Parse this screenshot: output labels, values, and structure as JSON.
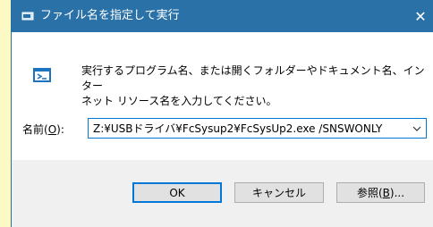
{
  "window": {
    "title": "ファイル名を指定して実行",
    "close_glyph": "✕"
  },
  "description": "実行するプログラム名、または開くフォルダーやドキュメント名、インター\nネット リソース名を入力してください。",
  "name_field": {
    "label_prefix": "名前(",
    "label_accel": "O",
    "label_suffix": "):",
    "value": "Z:¥USBドライバ¥FcSysup2¥FcSysUp2.exe  /SNSWONLY"
  },
  "buttons": {
    "ok": "OK",
    "cancel": "キャンセル",
    "browse_prefix": "参照(",
    "browse_accel": "B",
    "browse_suffix": ")..."
  },
  "colors": {
    "titlebar": "#2a71a8",
    "background_note": "#fdf9c4",
    "focus_border": "#0078d7"
  }
}
